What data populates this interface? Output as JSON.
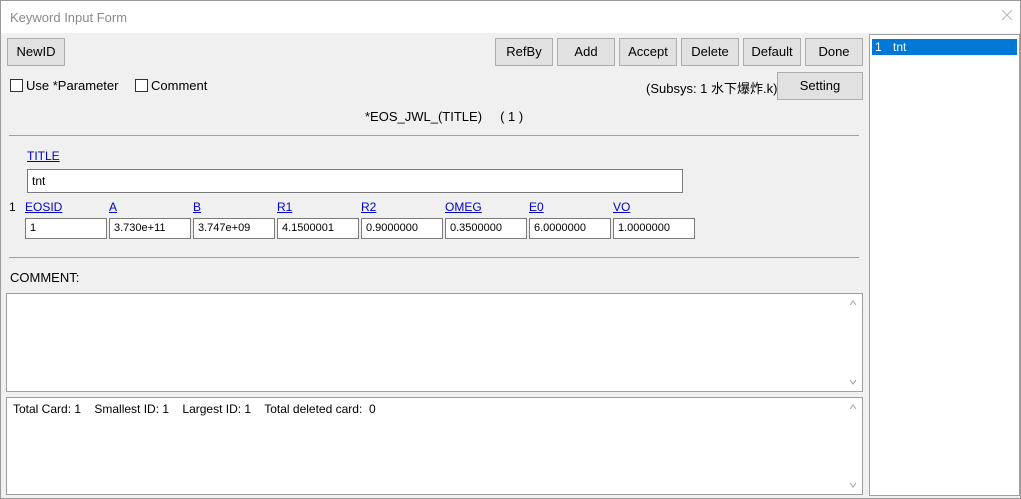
{
  "window": {
    "title": "Keyword Input Form"
  },
  "toolbar": {
    "newid": "NewID",
    "refby": "RefBy",
    "add": "Add",
    "accept": "Accept",
    "delete": "Delete",
    "default": "Default",
    "done": "Done",
    "setting": "Setting"
  },
  "options": {
    "use_parameter": "Use *Parameter",
    "comment": "Comment",
    "subsys": "(Subsys: 1 水下爆炸.k)"
  },
  "keyword": {
    "header": "*EOS_JWL_(TITLE)     ( 1 )"
  },
  "title_card": {
    "label": "TITLE",
    "value": "tnt"
  },
  "card1": {
    "row_number": "1",
    "fields": [
      {
        "label": "EOSID",
        "value": "1"
      },
      {
        "label": "A",
        "value": "3.730e+11"
      },
      {
        "label": "B",
        "value": "3.747e+09"
      },
      {
        "label": "R1",
        "value": "4.1500001"
      },
      {
        "label": "R2",
        "value": "0.9000000"
      },
      {
        "label": "OMEG",
        "value": "0.3500000"
      },
      {
        "label": "E0",
        "value": "6.0000000"
      },
      {
        "label": "VO",
        "value": "1.0000000"
      }
    ]
  },
  "comment_section": {
    "label": "COMMENT:",
    "text": ""
  },
  "status": {
    "text": "Total Card: 1    Smallest ID: 1    Largest ID: 1    Total deleted card:  0"
  },
  "id_list": {
    "items": [
      {
        "id": "1",
        "name": "tnt"
      }
    ]
  }
}
